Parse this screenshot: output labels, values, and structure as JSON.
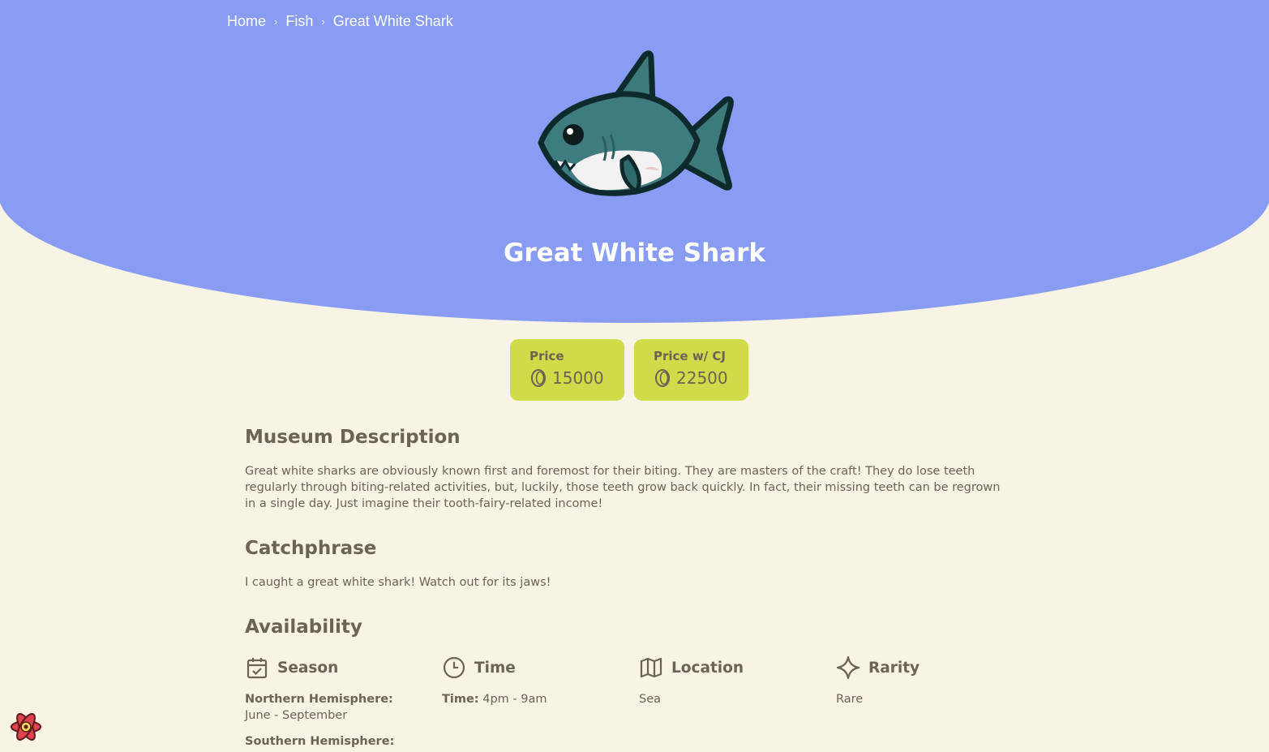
{
  "breadcrumb": {
    "items": [
      "Home",
      "Fish",
      "Great White Shark"
    ],
    "separator": "›"
  },
  "item": {
    "name": "Great White Shark",
    "image_icon": "shark-icon"
  },
  "prices": {
    "price_label": "Price",
    "price_value": "15000",
    "cj_label": "Price w/ CJ",
    "cj_value": "22500",
    "coin_icon": "bell-coin-icon"
  },
  "museum": {
    "heading": "Museum Description",
    "text": "Great white sharks are obviously known first and foremost for their biting. They are masters of the craft! They do lose teeth regularly through biting-related activities, but, luckily, those teeth grow back quickly. In fact, their missing teeth can be regrown in a single day. Just imagine their tooth-fairy-related income!"
  },
  "catchphrase": {
    "heading": "Catchphrase",
    "text": "I caught a great white shark! Watch out for its jaws!"
  },
  "availability": {
    "heading": "Availability",
    "season": {
      "label": "Season",
      "icon": "calendar-check-icon",
      "north_label": "Northern Hemisphere:",
      "north_value": "June - September",
      "south_label": "Southern Hemisphere:"
    },
    "time": {
      "label": "Time",
      "icon": "clock-icon",
      "time_label": "Time:",
      "time_value": "4pm - 9am"
    },
    "location": {
      "label": "Location",
      "icon": "map-icon",
      "value": "Sea"
    },
    "rarity": {
      "label": "Rarity",
      "icon": "sparkle-icon",
      "value": "Rare"
    }
  },
  "colors": {
    "hero": "#879cf2",
    "background": "#f7f3e5",
    "price_card": "#d1da48",
    "text": "#6b6353"
  }
}
